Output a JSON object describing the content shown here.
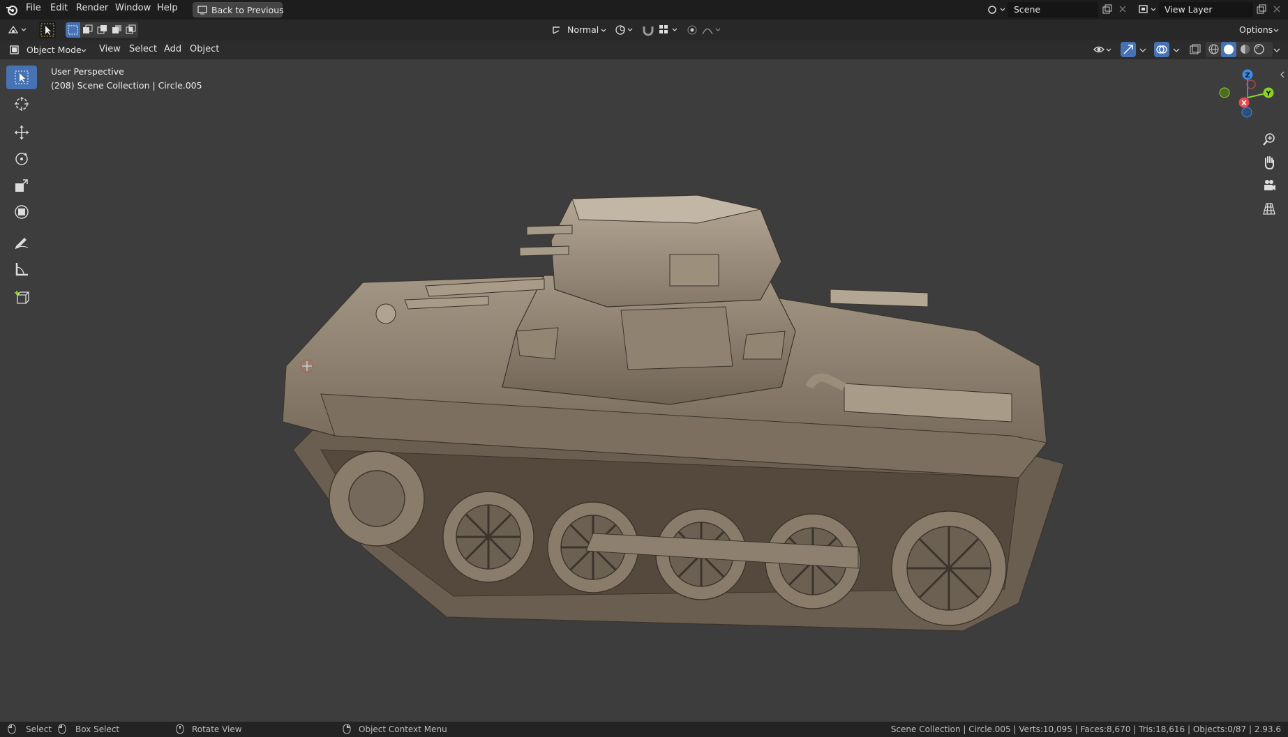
{
  "menubar": {
    "items": [
      "File",
      "Edit",
      "Render",
      "Window",
      "Help"
    ],
    "back_button": "Back to Previous",
    "scene_label": "Scene",
    "view_layer_label": "View Layer"
  },
  "toolbar": {
    "transform_orientation": "Normal",
    "options_label": "Options"
  },
  "viewport_header": {
    "mode": "Object Mode",
    "menus": [
      "View",
      "Select",
      "Add",
      "Object"
    ]
  },
  "viewport": {
    "perspective_label": "User Perspective",
    "collection_info": "(208) Scene Collection | Circle.005",
    "gizmo_axes": [
      "Z",
      "Y",
      "X"
    ]
  },
  "tools": [
    "select-box",
    "cursor",
    "move",
    "rotate",
    "scale",
    "transform",
    "annotate",
    "measure",
    "add-cube"
  ],
  "statusbar": {
    "select": "Select",
    "box_select": "Box Select",
    "rotate_view": "Rotate View",
    "context_menu": "Object Context Menu",
    "stats": "Scene Collection | Circle.005 | Verts:10,095 | Faces:8,670 | Tris:18,616 | Objects:0/87 | 2.93.6"
  },
  "colors": {
    "accent": "#4772b3",
    "viewport_bg": "#3d3d3d",
    "axis_x": "#e34a52",
    "axis_y": "#8bd12a",
    "axis_z": "#3b8ee8",
    "model": "#8a7b68"
  }
}
